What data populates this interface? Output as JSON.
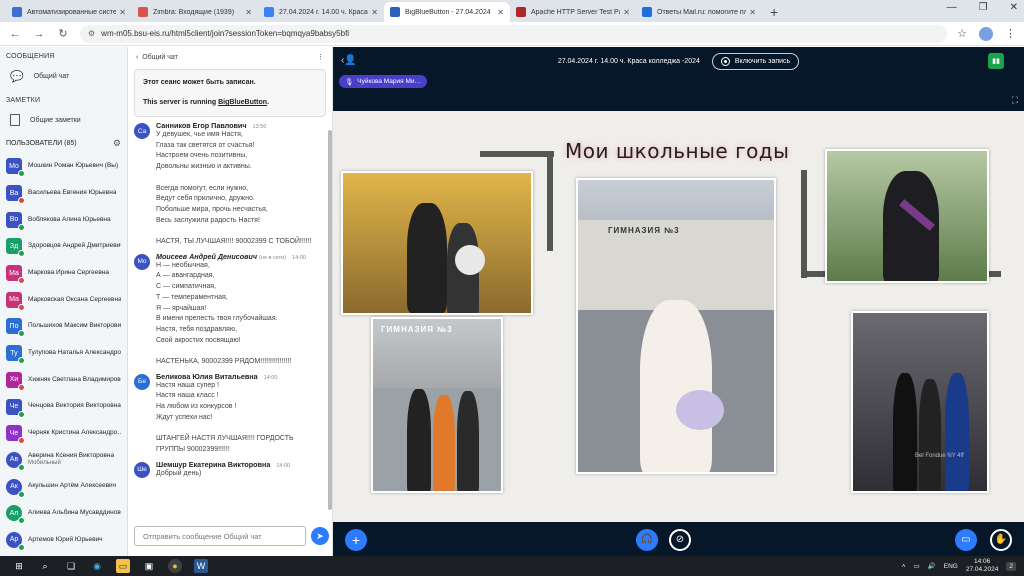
{
  "browser": {
    "tabs": [
      {
        "title": "Автоматизированные систе…",
        "favicon_color": "#3c6fd1",
        "active": false
      },
      {
        "title": "Zimbra: Входящие (1939)",
        "favicon_color": "#d9534f",
        "active": false
      },
      {
        "title": "27.04.2024 г. 14.00 ч. Краса к…",
        "favicon_color": "#3b82f6",
        "active": false
      },
      {
        "title": "BigBlueButton - 27.04.2024",
        "favicon_color": "#2d5fbf",
        "active": true
      },
      {
        "title": "Apache HTTP Server Test Page",
        "favicon_color": "#b0262a",
        "active": false
      },
      {
        "title": "Ответы Mail.ru: помогите пл…",
        "favicon_color": "#1e6fd9",
        "active": false
      }
    ],
    "url": "wm-m05.bsu-eis.ru/html5client/join?sessionToken=bqmqya9babsy5bfi"
  },
  "sidebar": {
    "messages_title": "СООБЩЕНИЯ",
    "public_chat": "Общий чат",
    "notes_title": "ЗАМЕТКИ",
    "shared_notes": "Общие заметки",
    "users_title": "ПОЛЬЗОВАТЕЛИ (85)",
    "users": [
      {
        "initials": "Мо",
        "name": "Мошкин Роман Юрьевич (Вы)",
        "color": "#3a52c4",
        "round": false,
        "sub": ""
      },
      {
        "initials": "Ва",
        "name": "Васильева Евгения Юрьевна",
        "color": "#3a52c4",
        "round": false,
        "sub": ""
      },
      {
        "initials": "Во",
        "name": "Воблякова Алина Юрьевна",
        "color": "#3a52c4",
        "round": false,
        "sub": ""
      },
      {
        "initials": "Зд",
        "name": "Здоровцов Андрей Дмитриевич",
        "color": "#1b9e6a",
        "round": false,
        "sub": ""
      },
      {
        "initials": "Ма",
        "name": "Маркова Ирина Сергеевна",
        "color": "#c8327a",
        "round": false,
        "sub": ""
      },
      {
        "initials": "Ма",
        "name": "Марковская Оксана Сергеевна",
        "color": "#c8327a",
        "round": false,
        "sub": ""
      },
      {
        "initials": "По",
        "name": "Польшихов Максим Викторович",
        "color": "#2b6fd6",
        "round": false,
        "sub": ""
      },
      {
        "initials": "Ту",
        "name": "Тулупова Наталья Александро…",
        "color": "#2b6fd6",
        "round": false,
        "sub": ""
      },
      {
        "initials": "Хи",
        "name": "Хижняк Светлана Владимиров…",
        "color": "#b0279a",
        "round": false,
        "sub": ""
      },
      {
        "initials": "Че",
        "name": "Ченцова Виктория Викторовна",
        "color": "#3a52c4",
        "round": false,
        "sub": ""
      },
      {
        "initials": "Че",
        "name": "Черняк Кристина Александро…",
        "color": "#8e33c9",
        "round": false,
        "sub": ""
      },
      {
        "initials": "Ав",
        "name": "Аверина Ксения Викторовна",
        "color": "#3a52c4",
        "round": true,
        "sub": "Мобильный"
      },
      {
        "initials": "Ак",
        "name": "Акульшин Артём Алексеевич",
        "color": "#3a52c4",
        "round": true,
        "sub": ""
      },
      {
        "initials": "Ал",
        "name": "Алиева Альбина Мусавддинов…",
        "color": "#1b9e6a",
        "round": true,
        "sub": ""
      },
      {
        "initials": "Ар",
        "name": "Артемов Юрий Юрьевич",
        "color": "#3a52c4",
        "round": true,
        "sub": ""
      }
    ]
  },
  "chat": {
    "header": "Общий чат",
    "welcome_line1": "Этот сеанс может быть записан.",
    "welcome_prefix": "This server is running ",
    "welcome_link": "BigBlueButton",
    "welcome_suffix": ".",
    "messages": [
      {
        "initials": "Са",
        "color": "#3a52c4",
        "name": "Санников Егор Павлович",
        "status": "",
        "time": "13:56",
        "lines": [
          "У девушек, чье имя Настя,",
          "Глаза так светятся от счастья!",
          "Настроем очень позитивны,",
          "Довольны жизнью и активны.",
          "",
          "Всегда помогут, если нужно,",
          "Ведут себя прилично, дружно.",
          "Побольше мира, прочь несчастья,",
          "Весь заслужила радость Настя!",
          "",
          "НАСТЯ, ТЫ ЛУЧШАЯ!!!! 90002399 С ТОБОЙ!!!!!!"
        ]
      },
      {
        "initials": "Мо",
        "color": "#3a52c4",
        "name": "Моисеев Андрей Денисович",
        "status": "(не в сети)",
        "time": "14:00",
        "lines": [
          "Н — необычная,",
          "А — авангардная,",
          "С — симпатичная,",
          "Т — темпераментная,",
          "Я — ярчайшая!",
          "В имени прелесть твоя глубочайшая.",
          "Настя, тебя поздравляю,",
          "Свой акростих посвящаю!",
          "",
          "НАСТЕНЬКА, 90002399 РЯДОМ!!!!!!!!!!!!!!!!"
        ]
      },
      {
        "initials": "Бе",
        "color": "#2b6fd6",
        "name": "Беликова Юлия Витальевна",
        "status": "",
        "time": "14:00",
        "lines": [
          "Настя наша супер !",
          "Настя наша класс !",
          "На любом из конкурсов !",
          "Ждут успехи нас!",
          "",
          "ШТАНГЕЙ НАСТЯ ЛУЧШАЯ!!!! ГОРДОСТЬ",
          "ГРУППЫ 90002399!!!!!!"
        ]
      },
      {
        "initials": "Ше",
        "color": "#3a52c4",
        "name": "Шемшур Екатерина Викторовна",
        "status": "",
        "time": "14:00",
        "lines": [
          "Добрый день)"
        ]
      }
    ],
    "input_placeholder": "Отправить сообщение Общий чат"
  },
  "main": {
    "meeting_title": "27.04.2024 г. 14.00 ч. Краса колледжа -2024",
    "record_label": "Включить запись",
    "talker": "Чуйкова Мария Ми…",
    "slide_title": "Мои школьные годы",
    "sign_text": "ГИМНАЗИЯ №3",
    "watermark": "Bel Fondue NY 4ff"
  },
  "taskbar": {
    "lang": "ENG",
    "time": "14:06",
    "date": "27.04.2024",
    "notif": "2"
  },
  "colors": {
    "accent": "#2d7cff",
    "main_bg": "#06172a",
    "online_green": "#1aa34a",
    "talker_purple": "#4a3fc9"
  }
}
